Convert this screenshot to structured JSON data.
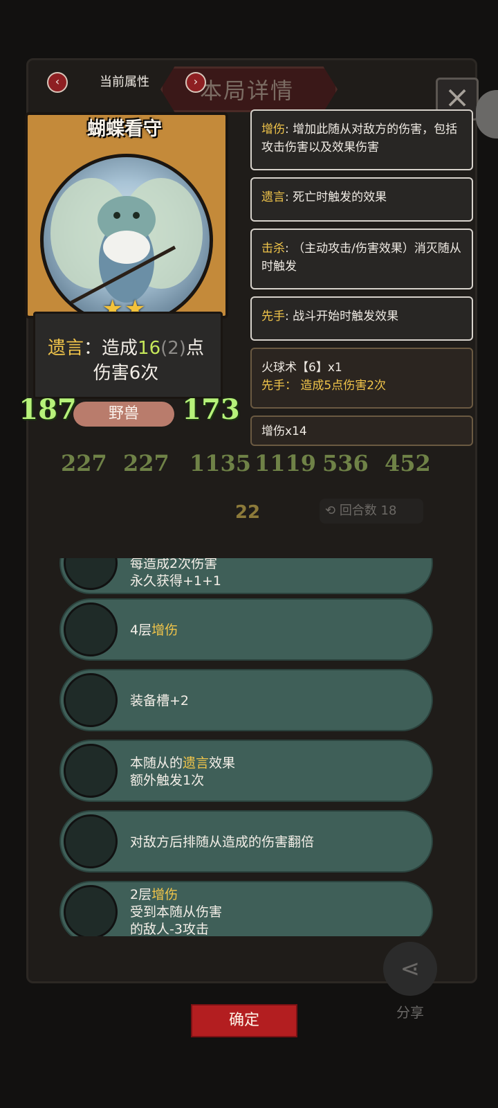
{
  "header": {
    "label": "当前属性",
    "background_title": "本局详情"
  },
  "card": {
    "name": "蝴蝶看守",
    "stars": 2,
    "stars_text": "★★",
    "desc": {
      "kw": "遗言",
      "colon": "：造成",
      "value": "16",
      "bonus": "(2)",
      "unit": "点",
      "line2": "伤害6次"
    },
    "stat_left": "187",
    "stat_right": "173",
    "tribe": "野兽"
  },
  "keywords": [
    {
      "name": "增伤",
      "text": ": 增加此随从对敌方的伤害，包括攻击伤害以及效果伤害"
    },
    {
      "name": "遗言",
      "text": ": 死亡时触发的效果"
    },
    {
      "name": "击杀",
      "text": ": （主动攻击/伤害效果）消灭随从时触发"
    },
    {
      "name": "先手",
      "text": ": 战斗开始时触发效果"
    }
  ],
  "effects": [
    {
      "title": "火球术【6】x1",
      "name": "先手",
      "text": "： 造成5点伤害2次"
    },
    {
      "title": "增伤x14"
    }
  ],
  "board_numbers": [
    "227",
    "227",
    "1135",
    "1119",
    "536",
    "452"
  ],
  "turn": "22",
  "round": {
    "label": "回合数",
    "value": "18"
  },
  "equipment": [
    {
      "line1": "每造成2次伤害",
      "line2": "永久获得+1+1"
    },
    {
      "line1": "4层",
      "kw": "增伤"
    },
    {
      "line1": "装备槽+2"
    },
    {
      "line1": "本随从的",
      "kw": "遗言",
      "after": "效果",
      "line2": "额外触发1次"
    },
    {
      "line1": "对敌方后排随从造成的伤害翻倍"
    },
    {
      "line1": "2层",
      "kw": "增伤",
      "line2": "受到本随从伤害",
      "line3": "的敌人-3攻击"
    }
  ],
  "share_label": "分享",
  "confirm_label": "确定",
  "colors": {
    "accent_gold": "#f0c44a",
    "stat_green": "#b7f27a",
    "confirm_red": "#b31e20",
    "row_teal": "#3f5f58"
  }
}
